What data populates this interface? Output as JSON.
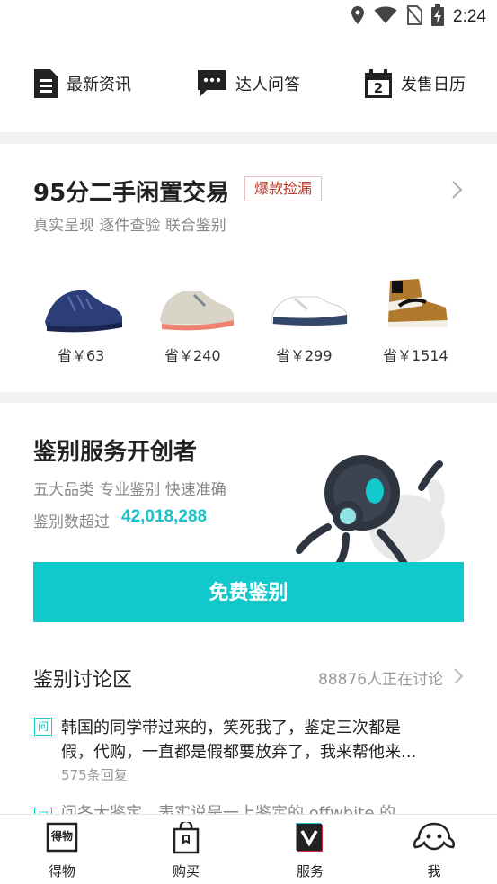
{
  "status_bar": {
    "time": "2:24",
    "icons": [
      "location-icon",
      "wifi-icon",
      "no-sim-icon",
      "battery-charging-icon"
    ]
  },
  "quick_nav": [
    {
      "label": "最新资讯",
      "icon": "news-icon"
    },
    {
      "label": "达人问答",
      "icon": "chat-bubble-icon"
    },
    {
      "label": "发售日历",
      "icon": "calendar-icon"
    }
  ],
  "calendar_day": "2",
  "trade": {
    "title": "95分二手闲置交易",
    "badge": "爆款捡漏",
    "subtitle": "真实呈现 逐件查验 联合鉴别",
    "items": [
      {
        "price": "省￥63",
        "shoe_color": "#2c3e78"
      },
      {
        "price": "省￥240",
        "shoe_color": "#d9d4c8"
      },
      {
        "price": "省￥299",
        "shoe_color": "#33476b"
      },
      {
        "price": "省￥1514",
        "shoe_color": "#b07a2e"
      }
    ]
  },
  "auth": {
    "title": "鉴别服务开创者",
    "subtitle": "五大品类 专业鉴别 快速准确",
    "count_label": "鉴别数超过",
    "count": "42,018,288",
    "cta": "免费鉴别"
  },
  "discussion": {
    "title": "鉴别讨论区",
    "count": "88876人正在讨论",
    "tag": "问",
    "post_line1": "韩国的同学带过来的，笑死我了，鉴定三次都是",
    "post_line2": "假，代购，一直都是假都要放弃了，我来帮他来...",
    "replies": "575条回复",
    "post2_partial": "问各大鉴定，表实说是一上鉴定的 offwhite 的..."
  },
  "tabs": [
    {
      "label": "得物",
      "icon": "dewu-logo-icon",
      "logo_text": "得物"
    },
    {
      "label": "购买",
      "icon": "shopping-bag-icon"
    },
    {
      "label": "服务",
      "icon": "service-v-icon"
    },
    {
      "label": "我",
      "icon": "profile-mascot-icon"
    }
  ],
  "colors": {
    "accent": "#11c8cb",
    "count": "#19c0c6",
    "badge": "#c0392b"
  }
}
